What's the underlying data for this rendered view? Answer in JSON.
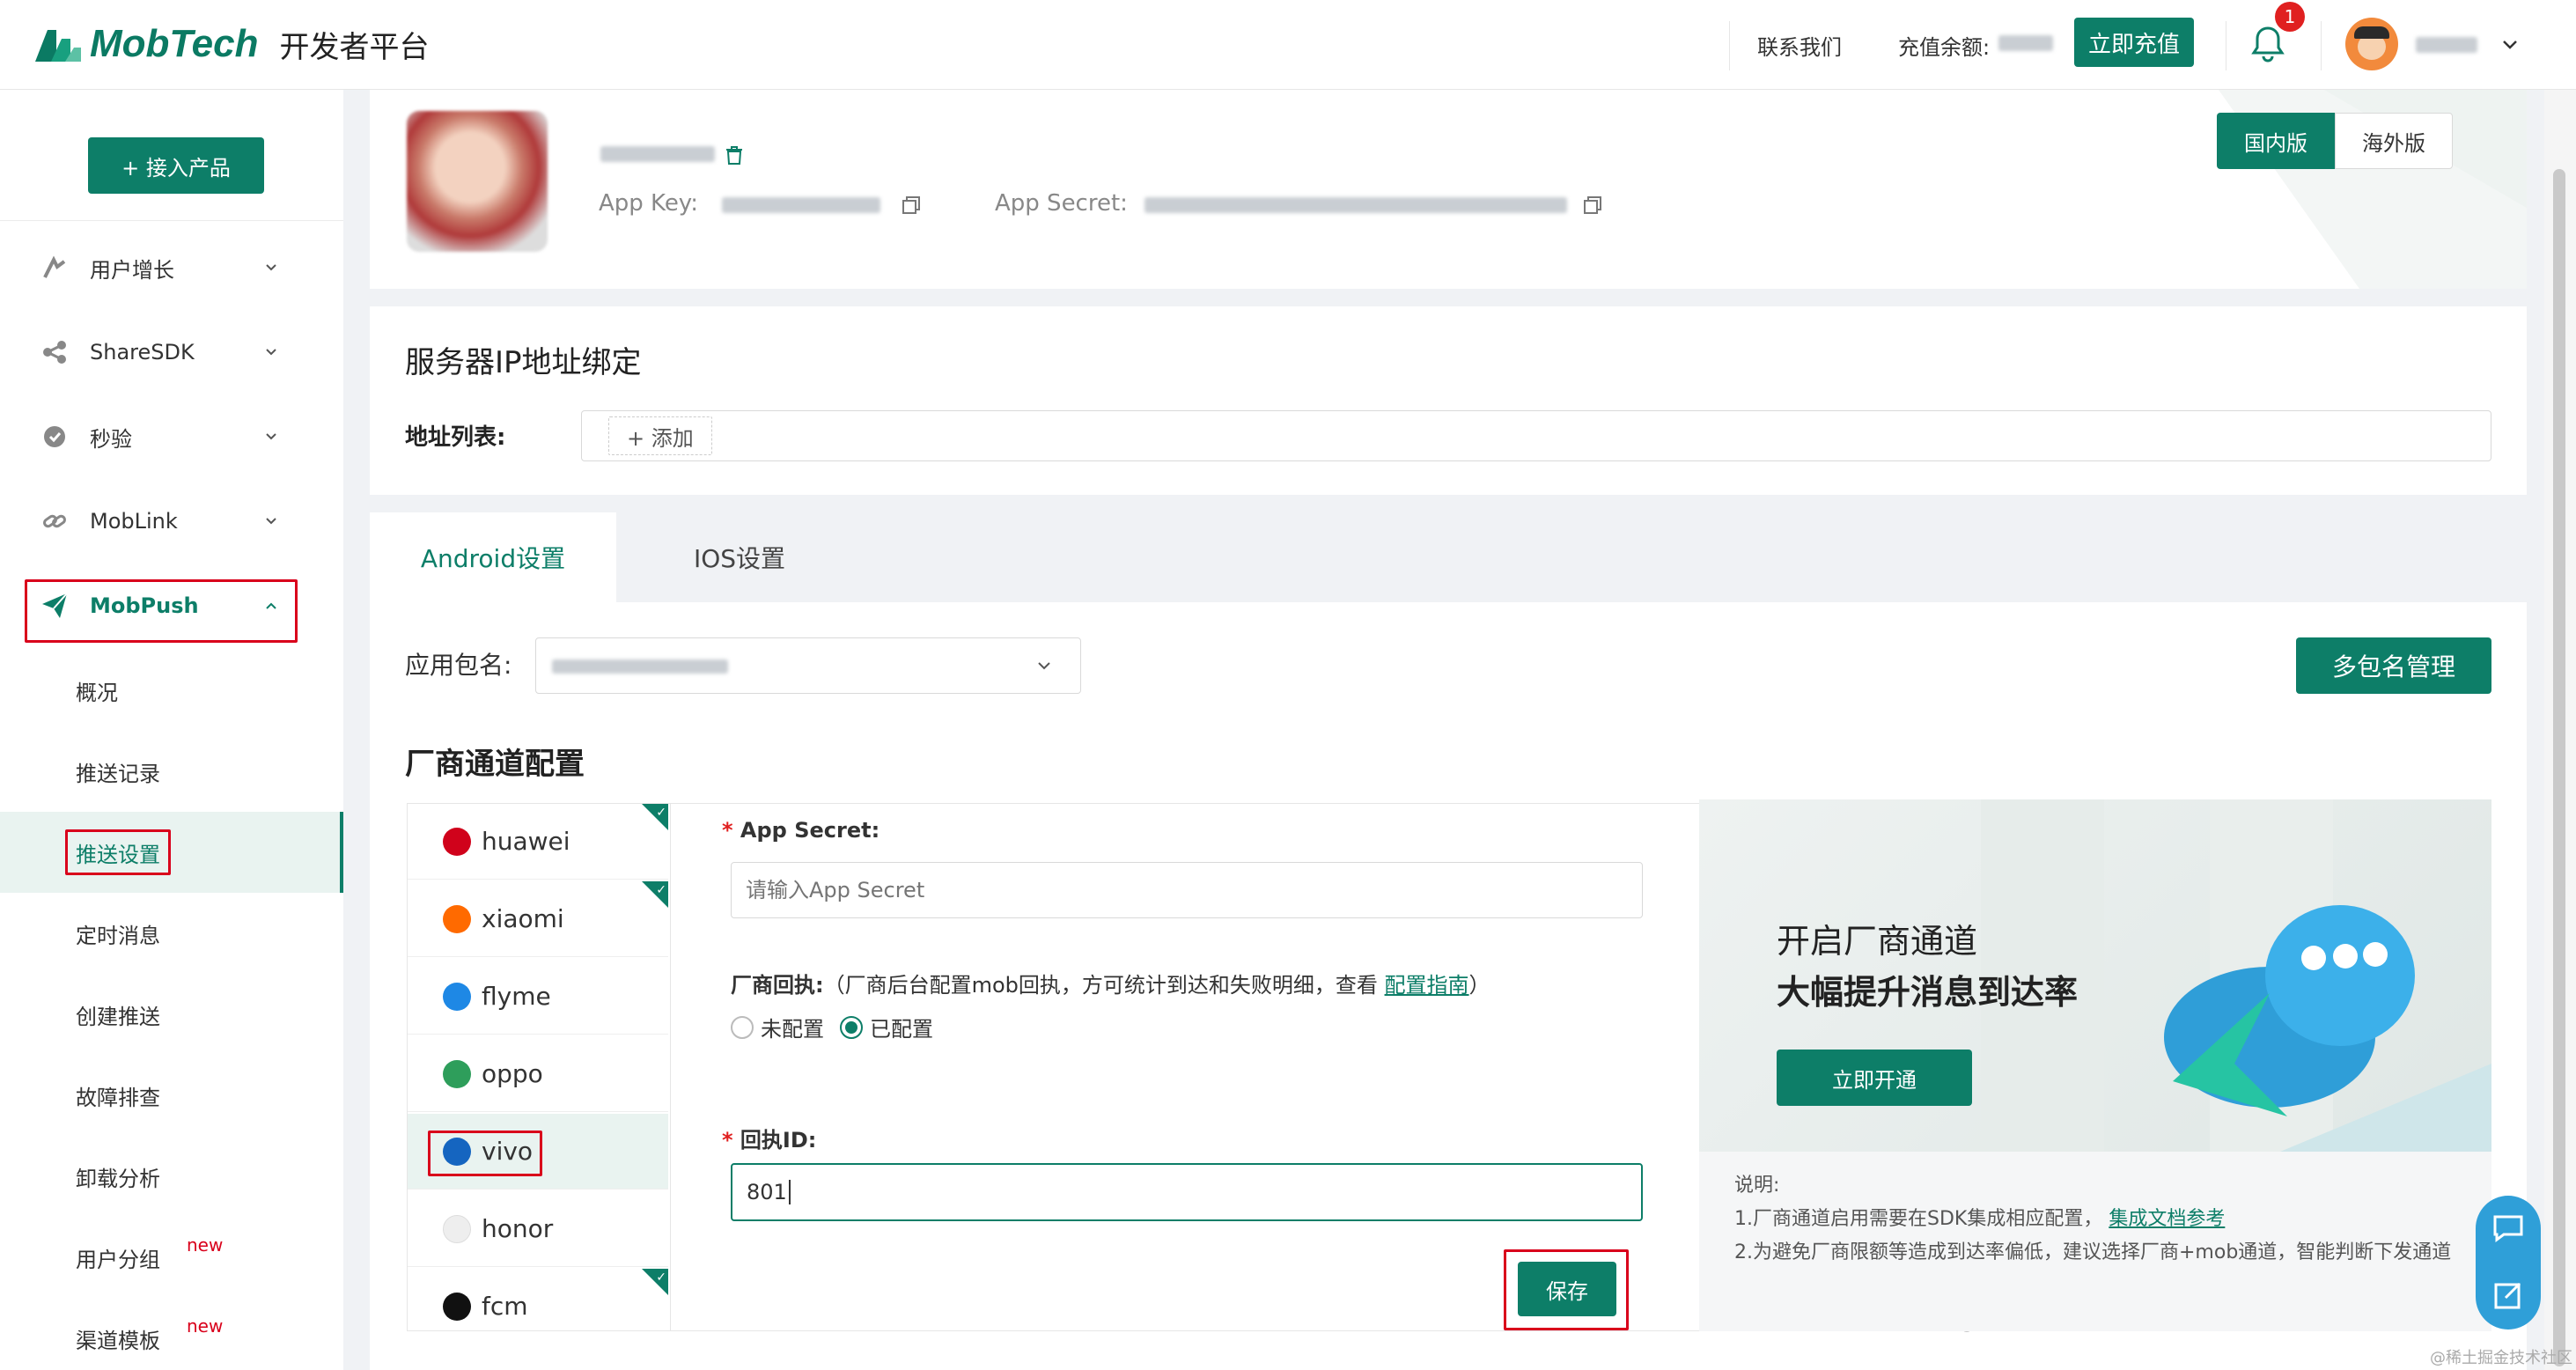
{
  "header": {
    "logo_text": "MobTech",
    "logo_sub": "开发者平台",
    "contact": "联系我们",
    "balance_label": "充值余额:",
    "recharge_button": "立即充值",
    "notification_count": "1"
  },
  "sidebar": {
    "add_product_button": "+ 接入产品",
    "items": [
      {
        "label": "用户增长",
        "icon": "growth-icon"
      },
      {
        "label": "ShareSDK",
        "icon": "share-icon"
      },
      {
        "label": "秒验",
        "icon": "verify-icon"
      },
      {
        "label": "MobLink",
        "icon": "link-icon"
      },
      {
        "label": "MobPush",
        "icon": "paper-plane-icon"
      }
    ],
    "sub_items": [
      "概况",
      "推送记录",
      "推送设置",
      "定时消息",
      "创建推送",
      "故障排查",
      "卸载分析",
      "用户分组",
      "渠道模板"
    ],
    "new_badge": "new"
  },
  "app_header": {
    "app_key_label": "App Key:",
    "app_secret_label": "App Secret:",
    "region_tabs": [
      "国内版",
      "海外版"
    ]
  },
  "ip_binding": {
    "title": "服务器IP地址绑定",
    "list_label": "地址列表:",
    "add_button": "+ 添加"
  },
  "platform_tabs": [
    "Android设置",
    "IOS设置"
  ],
  "package": {
    "label": "应用包名:",
    "manage_button": "多包名管理"
  },
  "vendor": {
    "title": "厂商通道配置",
    "channels": [
      {
        "name": "huawei",
        "configured": true,
        "color": "#d0021b"
      },
      {
        "name": "xiaomi",
        "configured": true,
        "color": "#ff6a00"
      },
      {
        "name": "flyme",
        "configured": false,
        "color": "#1e88e5"
      },
      {
        "name": "oppo",
        "configured": false,
        "color": "#2e9e5b"
      },
      {
        "name": "vivo",
        "configured": false,
        "color": "#1565c0"
      },
      {
        "name": "honor",
        "configured": false,
        "color": "#e0e0e0"
      },
      {
        "name": "fcm",
        "configured": true,
        "color": "#111111"
      }
    ],
    "form": {
      "secret_label": "App Secret:",
      "secret_placeholder": "请输入App Secret",
      "receipt_label": "厂商回执:",
      "receipt_desc": "（厂商后台配置mob回执，方可统计到达和失败明细，查看",
      "receipt_link": "配置指南",
      "receipt_close": "）",
      "radio_unconfigured": "未配置",
      "radio_configured": "已配置",
      "receipt_id_label": "回执ID:",
      "receipt_id_value": "801",
      "save_button": "保存"
    }
  },
  "promo": {
    "line1": "开启厂商通道",
    "line2": "大幅提升消息到达率",
    "button": "立即开通",
    "note_title": "说明:",
    "note1": "1.厂商通道启用需要在SDK集成相应配置，",
    "note1_link": "集成文档参考",
    "note2": "2.为避免厂商限额等造成到达率偏低，建议选择厂商+mob通道，智能判断下发通道"
  },
  "watermark": "@稀土掘金技术社区",
  "colors": {
    "brand": "#0d7e68",
    "alert": "#d9001b"
  }
}
